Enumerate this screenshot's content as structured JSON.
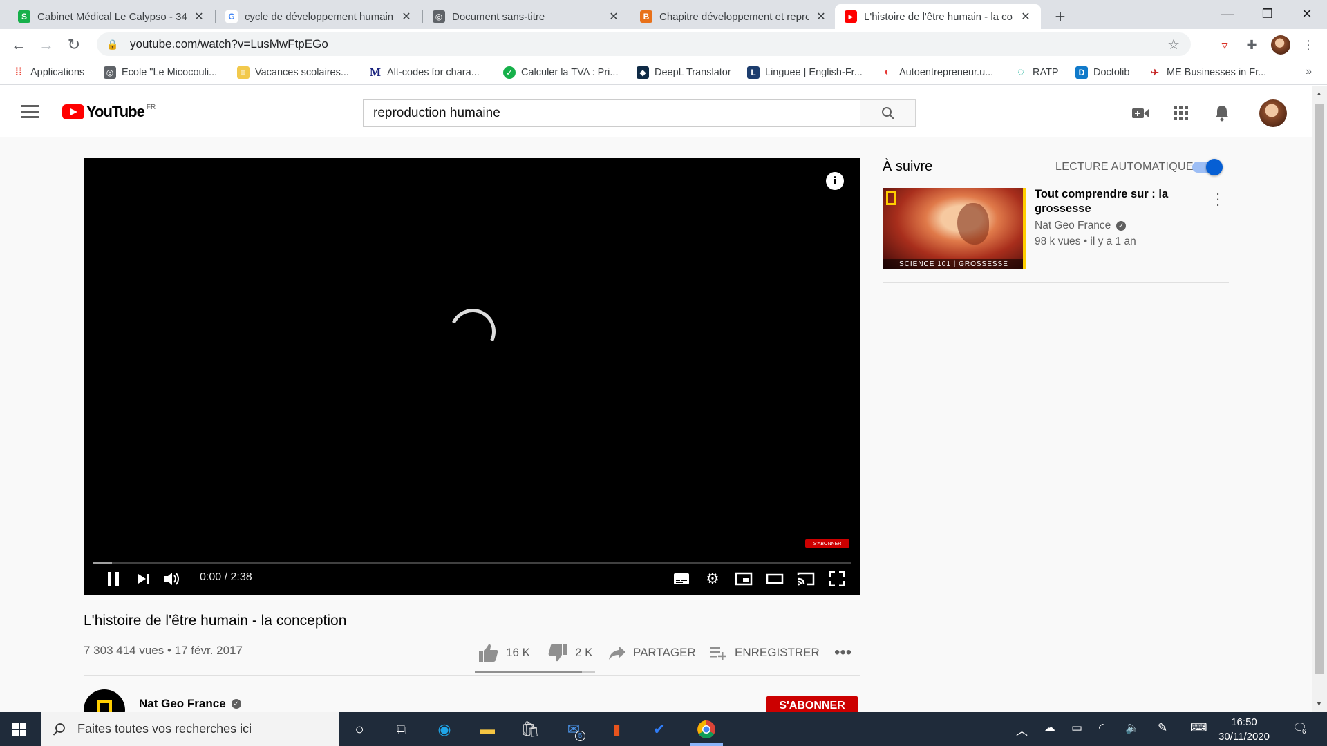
{
  "browser": {
    "tabs": [
      {
        "title": "Cabinet Médical Le Calypso - 34",
        "favicon_color": "#16b04a",
        "favicon_glyph": "S"
      },
      {
        "title": "cycle de développement humain",
        "favicon_color": "#ffffff",
        "favicon_glyph": "G"
      },
      {
        "title": "Document sans-titre",
        "favicon_color": "#5f6368",
        "favicon_glyph": "◎"
      },
      {
        "title": "Chapitre développement et repro",
        "favicon_color": "#e8711a",
        "favicon_glyph": "B"
      },
      {
        "title": "L'histoire de l'être humain - la co",
        "favicon_color": "#ff0000",
        "favicon_glyph": "▶"
      }
    ],
    "new_tab": "+",
    "url": "youtube.com/watch?v=LusMwFtpEGo",
    "bookmarks": [
      {
        "label": "Applications",
        "icon_color": "#ea4335",
        "glyph": "⋮"
      },
      {
        "label": "Ecole \"Le Micocouli...",
        "icon_color": "#5f6368",
        "glyph": "◎"
      },
      {
        "label": "Vacances scolaires...",
        "icon_color": "#f2c94c",
        "glyph": "≡"
      },
      {
        "label": "Alt-codes for chara...",
        "icon_color": "#ffffff",
        "glyph": "M"
      },
      {
        "label": "Calculer la TVA : Pri...",
        "icon_color": "#16b04a",
        "glyph": "✓"
      },
      {
        "label": "DeepL Translator",
        "icon_color": "#0f2b46",
        "glyph": "◆"
      },
      {
        "label": "Linguee | English-Fr...",
        "icon_color": "#1d3d6e",
        "glyph": "L"
      },
      {
        "label": "Autoentrepreneur.u...",
        "icon_color": "#e53935",
        "glyph": "◐"
      },
      {
        "label": "RATP",
        "icon_color": "#00a88f",
        "glyph": "◌"
      },
      {
        "label": "Doctolib",
        "icon_color": "#107aca",
        "glyph": "D"
      },
      {
        "label": "ME Businesses in Fr...",
        "icon_color": "#c62828",
        "glyph": "✈"
      }
    ],
    "bookmarks_more": "»"
  },
  "youtube": {
    "logo_text": "YouTube",
    "country_code": "FR",
    "search_value": "reproduction humaine",
    "player": {
      "time_display": "0:00 / 2:38",
      "buffered_fraction": 0.025,
      "watermark": "S'ABONNER"
    },
    "video": {
      "title": "L'histoire de l'être humain - la conception",
      "views_date": "7 303 414 vues • 17 févr. 2017",
      "likes": "16 K",
      "dislikes": "2 K",
      "share": "PARTAGER",
      "save": "ENREGISTRER",
      "like_ratio": 0.89
    },
    "channel": {
      "name": "Nat Geo France",
      "subscribe_label": "S'ABONNER"
    },
    "up_next": {
      "heading": "À suivre",
      "autoplay_label": "LECTURE AUTOMATIQUE",
      "autoplay_on": true,
      "items": [
        {
          "title": "Tout comprendre sur : la grossesse",
          "channel": "Nat Geo France",
          "meta": "98 k vues • il y a 1 an",
          "thumb_caption": "SCIENCE 101 | GROSSESSE"
        }
      ]
    }
  },
  "taskbar": {
    "search_placeholder": "Faites toutes vos recherches ici",
    "mail_badge": "5",
    "time": "16:50",
    "date": "30/11/2020",
    "notifications": "6"
  }
}
